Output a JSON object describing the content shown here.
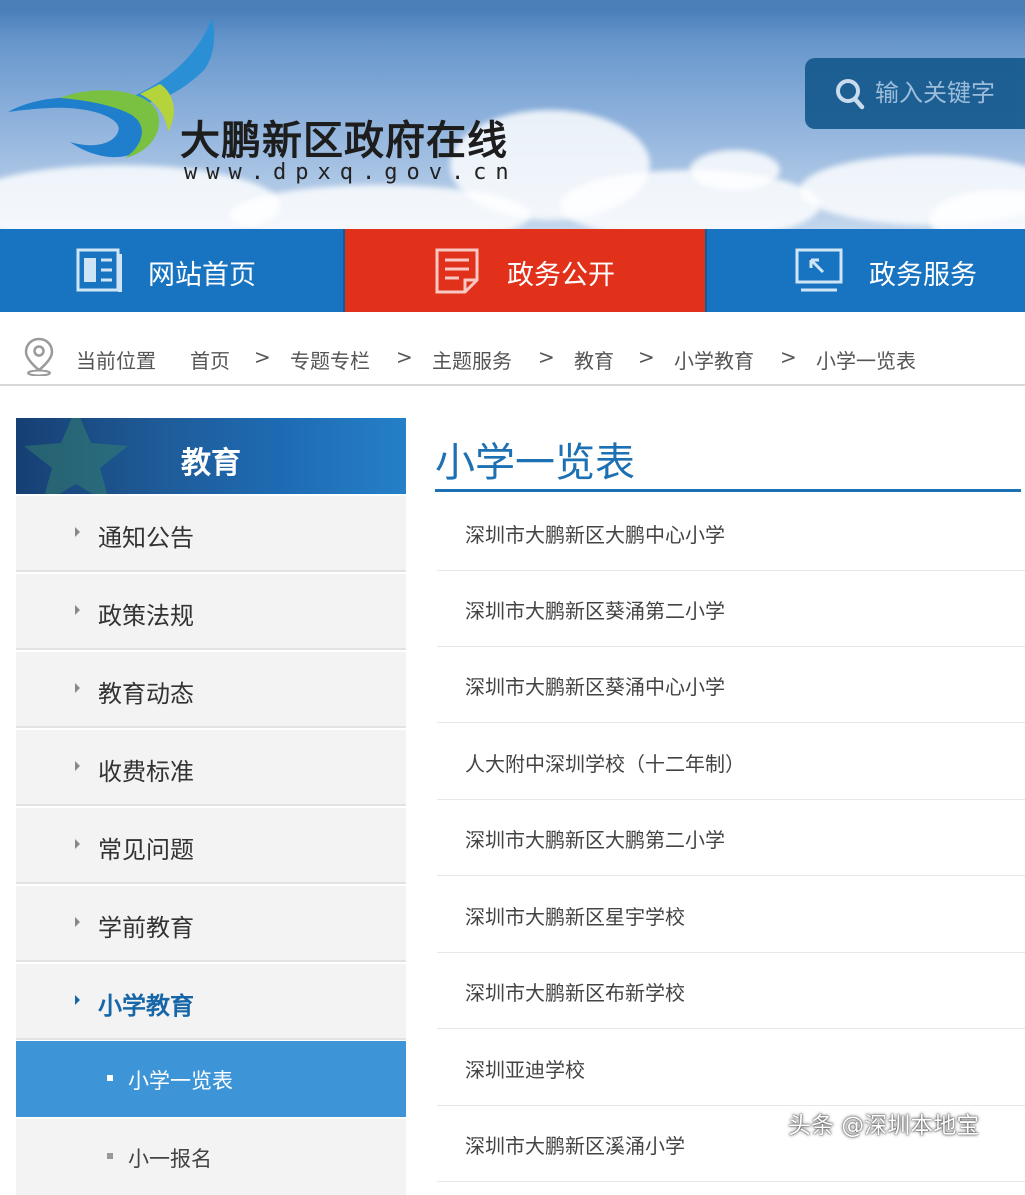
{
  "header": {
    "site_name": "大鹏新区政府在线",
    "site_url": "www.dpxq.gov.cn",
    "search": {
      "placeholder": "输入关键字",
      "icon": "search-icon"
    }
  },
  "nav": [
    {
      "label": "网站首页",
      "icon": "newspaper-icon",
      "color": "#1874c0"
    },
    {
      "label": "政务公开",
      "icon": "document-icon",
      "color": "#e2311b"
    },
    {
      "label": "政务服务",
      "icon": "monitor-icon",
      "color": "#1874c0"
    }
  ],
  "breadcrumb": {
    "prefix": "当前位置",
    "items": [
      "首页",
      "专题专栏",
      "主题服务",
      "教育",
      "小学教育",
      "小学一览表"
    ],
    "separator": ">"
  },
  "sidebar": {
    "title": "教育",
    "items": [
      {
        "label": "通知公告"
      },
      {
        "label": "政策法规"
      },
      {
        "label": "教育动态"
      },
      {
        "label": "收费标准"
      },
      {
        "label": "常见问题"
      },
      {
        "label": "学前教育"
      },
      {
        "label": "小学教育",
        "active": true
      }
    ],
    "sub_items": [
      {
        "label": "小学一览表",
        "active": true
      },
      {
        "label": "小一报名"
      }
    ]
  },
  "main": {
    "title": "小学一览表",
    "list": [
      "深圳市大鹏新区大鹏中心小学",
      "深圳市大鹏新区葵涌第二小学",
      "深圳市大鹏新区葵涌中心小学",
      "人大附中深圳学校（十二年制）",
      "深圳市大鹏新区大鹏第二小学",
      "深圳市大鹏新区星宇学校",
      "深圳市大鹏新区布新学校",
      "深圳亚迪学校",
      "深圳市大鹏新区溪涌小学"
    ]
  },
  "watermark": "头条 @深圳本地宝",
  "colors": {
    "accent_blue": "#1874c0",
    "accent_red": "#e2311b",
    "title_blue": "#1d70b2",
    "sub_active": "#3d95d7"
  }
}
